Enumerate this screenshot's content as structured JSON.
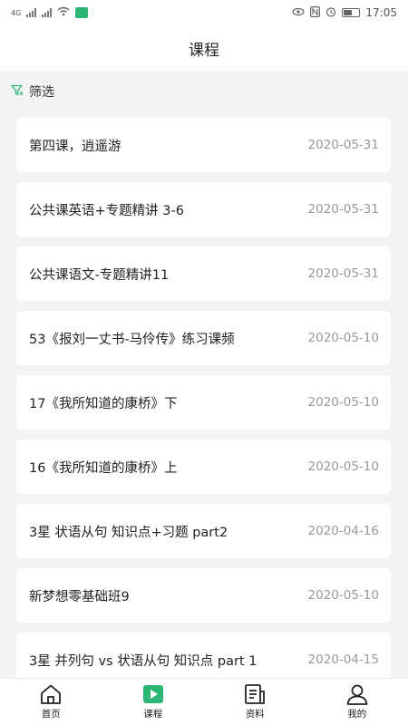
{
  "status_bar": {
    "network": "4G",
    "time": "17:05"
  },
  "header": {
    "title": "课程"
  },
  "filter": {
    "label": "筛选"
  },
  "courses": [
    {
      "title": "第四课，逍遥游",
      "date": "2020-05-31"
    },
    {
      "title": "公共课英语+专题精讲 3-6",
      "date": "2020-05-31"
    },
    {
      "title": "公共课语文-专题精讲11",
      "date": "2020-05-31"
    },
    {
      "title": "53《报刘一丈书-马伶传》练习课频",
      "date": "2020-05-10"
    },
    {
      "title": "17《我所知道的康桥》下",
      "date": "2020-05-10"
    },
    {
      "title": "16《我所知道的康桥》上",
      "date": "2020-05-10"
    },
    {
      "title": "3星 状语从句 知识点+习题 part2",
      "date": "2020-04-16"
    },
    {
      "title": "新梦想零基础班9",
      "date": "2020-05-10"
    },
    {
      "title": "3星 并列句 vs 状语从句 知识点 part 1",
      "date": "2020-04-15"
    }
  ],
  "tabs": [
    {
      "label": "首页",
      "icon": "home-icon"
    },
    {
      "label": "课程",
      "icon": "play-icon",
      "active": true
    },
    {
      "label": "资料",
      "icon": "document-icon"
    },
    {
      "label": "我的",
      "icon": "user-icon"
    }
  ],
  "colors": {
    "accent": "#2bb673",
    "background": "#f2f3f5"
  }
}
